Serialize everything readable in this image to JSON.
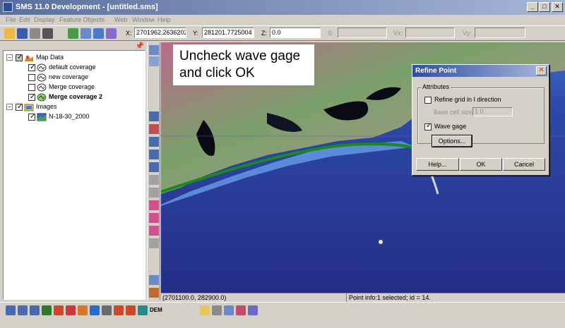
{
  "window": {
    "title": "SMS 11.0 Development - [untitled.sms]",
    "minimize_label": "_",
    "maximize_label": "□",
    "close_label": "✕"
  },
  "menu": {
    "items": [
      "File",
      "Edit",
      "Display",
      "Feature Objects",
      "Web",
      "Window",
      "Help"
    ]
  },
  "toolbar": {
    "x_label": "X:",
    "x_value": "2701962.2636202",
    "y_label": "Y:",
    "y_value": "281201.7725004",
    "z_label": "Z:",
    "z_value": "0.0",
    "s_label": "S:",
    "vx_label": "Vx:",
    "vy_label": "Vy:"
  },
  "tree": {
    "root_map": "Map Data",
    "coverages": [
      {
        "label": "default coverage",
        "checked": true
      },
      {
        "label": "new coverage",
        "checked": false
      },
      {
        "label": "Merge coverage",
        "checked": false
      },
      {
        "label": "Merge coverage 2",
        "checked": true
      }
    ],
    "root_images": "Images",
    "image_item": "N-18-30_2000"
  },
  "instruction": {
    "line1": "Uncheck wave gage",
    "line2": "and click OK"
  },
  "dialog": {
    "title": "Refine Point",
    "group_label": "Attributes",
    "refine_grid_label": "Refine grid in I direction",
    "refine_grid_checked": false,
    "base_cell_label": "Base cell size:",
    "base_cell_value": "1.0",
    "wave_gage_label": "Wave gage",
    "wave_gage_checked": true,
    "options_label": "Options...",
    "help_label": "Help...",
    "ok_label": "OK",
    "cancel_label": "Cancel"
  },
  "status": {
    "coords": "(2701100.0, 282900.0)",
    "info": "Point info:1 selected; id = 14."
  },
  "bottom_toolbar": {
    "dem_label": "DEM"
  },
  "colors": {
    "water_deep": "#2a3a8c",
    "water_shallow": "#3f6fcf",
    "coastline_green": "#1a8a1a",
    "title_blue": "#2f4ea0"
  }
}
